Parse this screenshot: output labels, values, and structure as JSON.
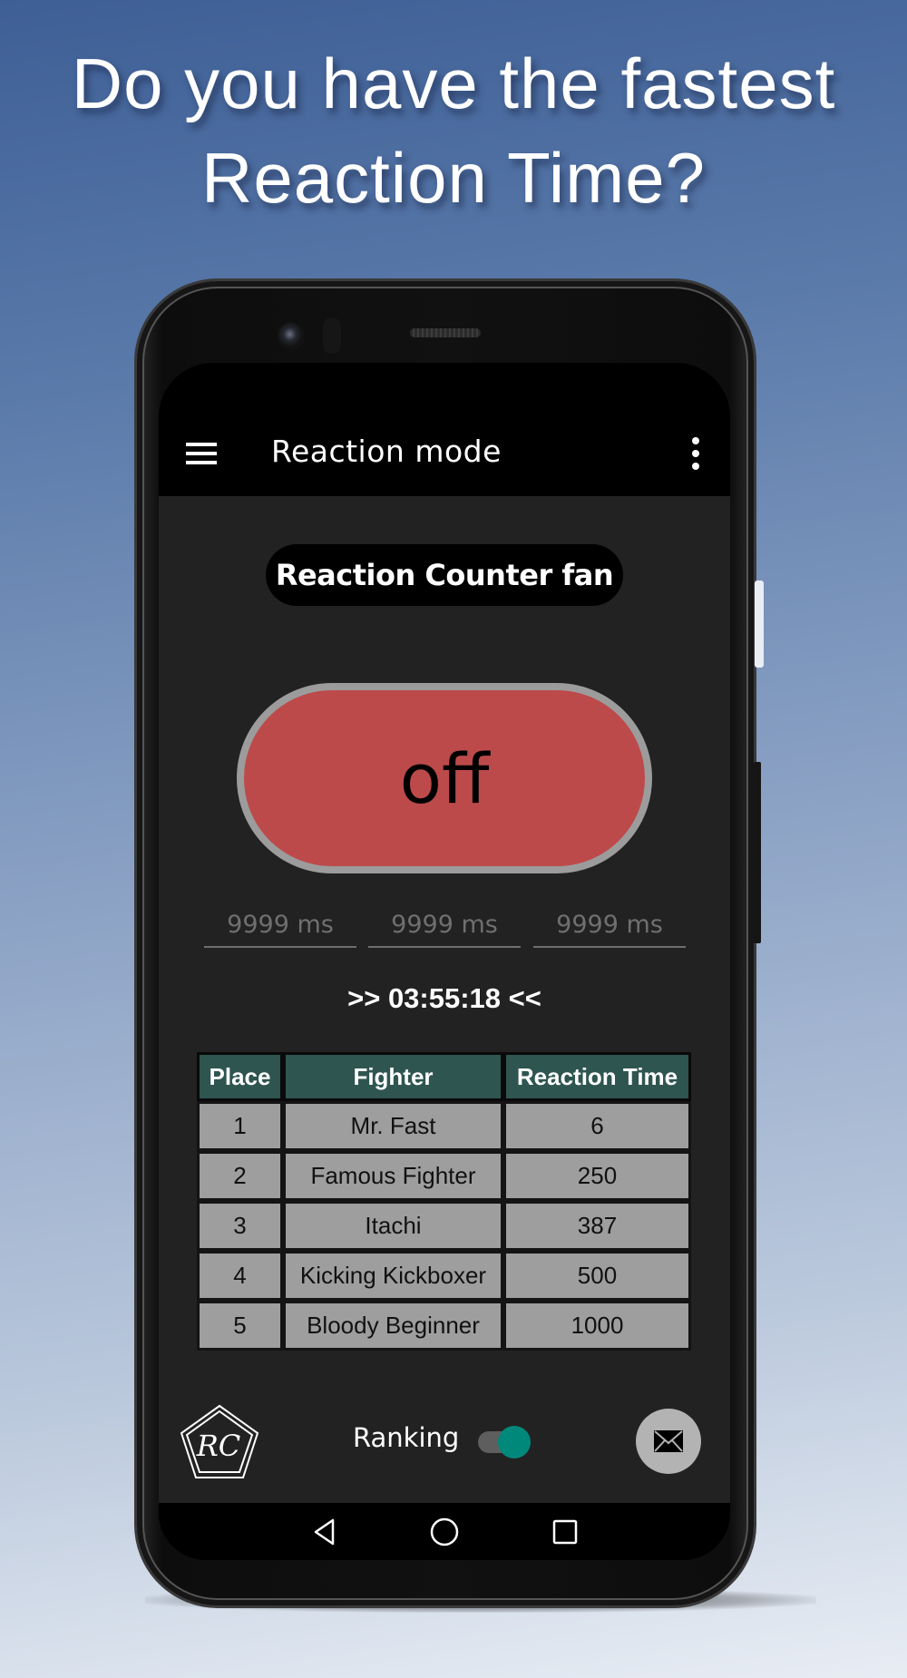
{
  "promo": {
    "headline_line1": "Do you have the fastest",
    "headline_line2": "Reaction Time?"
  },
  "app": {
    "title": "Reaction mode",
    "user_name": "Reaction Counter fan",
    "main_button_label": "off",
    "main_button_color": "#bd4a4a",
    "reaction_fields": [
      {
        "placeholder": "9999 ms"
      },
      {
        "placeholder": "9999 ms"
      },
      {
        "placeholder": "9999 ms"
      }
    ],
    "timer": ">> 03:55:18 <<"
  },
  "table": {
    "headers": [
      "Place",
      "Fighter",
      "Reaction Time"
    ],
    "header_color": "#2f5550",
    "rows": [
      {
        "place": "1",
        "fighter": "Mr. Fast",
        "time": "6"
      },
      {
        "place": "2",
        "fighter": "Famous Fighter",
        "time": "250"
      },
      {
        "place": "3",
        "fighter": "Itachi",
        "time": "387"
      },
      {
        "place": "4",
        "fighter": "Kicking Kickboxer",
        "time": "500"
      },
      {
        "place": "5",
        "fighter": "Bloody Beginner",
        "time": "1000"
      }
    ]
  },
  "bottom": {
    "logo_text": "RC",
    "ranking_label": "Ranking",
    "ranking_enabled": true,
    "toggle_color": "#00897b"
  },
  "icons": {
    "menu": "hamburger-menu-icon",
    "overflow": "more-vert-icon",
    "mail": "envelope-icon",
    "nav_back": "triangle-back-icon",
    "nav_home": "circle-home-icon",
    "nav_recents": "square-recents-icon"
  }
}
